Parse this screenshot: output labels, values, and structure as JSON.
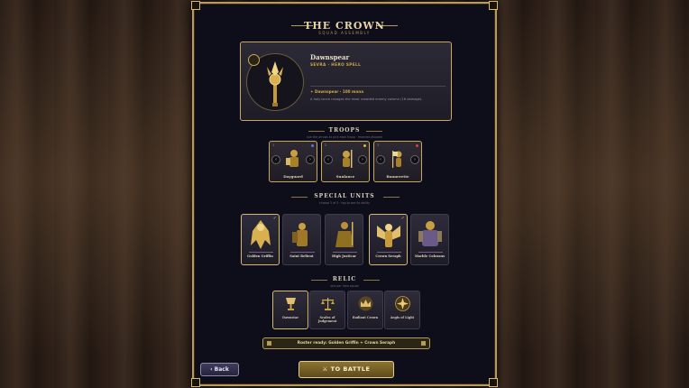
{
  "header": {
    "title": "THE CROWN",
    "subtitle": "SQUAD ASSEMBLY"
  },
  "spell": {
    "name": "Dawnspear",
    "type": "SEVRA · HERO SPELL",
    "cost": "✦ Dawnspear · 100 mana",
    "description": "A holy lance ravages the most crowded enemy column (16 damage)."
  },
  "troops": {
    "title": "TROOPS",
    "hint": "use the arrows to pick each troop · reserves allowed",
    "items": [
      {
        "num": "1",
        "name": "Dayguard",
        "dot_color": "#5a7ad8"
      },
      {
        "num": "2",
        "name": "Sunlance",
        "dot_color": "#d8b840"
      },
      {
        "num": "3",
        "name": "Bannerette",
        "dot_color": "#d84040"
      }
    ],
    "prev_label": "‹",
    "next_label": "›"
  },
  "special_units": {
    "title": "SPECIAL UNITS",
    "hint": "choose 2 of 5 · tap to see its ability",
    "items": [
      {
        "name": "Golden Griffin",
        "selected": true
      },
      {
        "name": "Saint Relient",
        "selected": false
      },
      {
        "name": "High Justicar",
        "selected": false
      },
      {
        "name": "Crown Seraph",
        "selected": true
      },
      {
        "name": "Marble Colossus",
        "selected": false
      }
    ],
    "check": "✓"
  },
  "relic": {
    "title": "RELIC",
    "hint": "one per hero squad",
    "items": [
      {
        "name": "Dawnstar",
        "selected": true
      },
      {
        "name": "Scales of Judgement",
        "selected": false
      },
      {
        "name": "Radiant Crown",
        "selected": false
      },
      {
        "name": "Aegis of Light",
        "selected": false
      }
    ]
  },
  "status": {
    "roster": "Roster ready: Golden Griffin + Crown Seraph"
  },
  "buttons": {
    "back": "‹ Back",
    "battle": "TO BATTLE"
  },
  "colors": {
    "gold": "#c8a860",
    "panel_bg": "#0e0e1a",
    "card_bg": "#2c2a36"
  }
}
